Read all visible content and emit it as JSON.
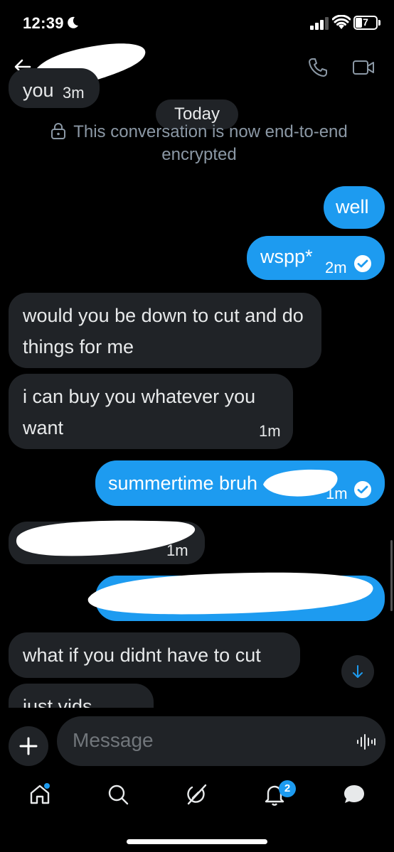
{
  "status_bar": {
    "time": "12:39",
    "battery_level": "7"
  },
  "conversation": {
    "earlier_fragment": {
      "text": "you",
      "time": "3m"
    },
    "date_separator": "Today",
    "encryption_notice": "This conversation is now end-to-end encrypted",
    "messages": [
      {
        "direction": "out",
        "text": "well",
        "time": ""
      },
      {
        "direction": "out",
        "text": "wspp*",
        "time": "2m"
      },
      {
        "direction": "in",
        "text": "would you be down to cut and do things for me",
        "time": ""
      },
      {
        "direction": "in",
        "text": "i can buy you whatever you want",
        "time": "1m"
      },
      {
        "direction": "out",
        "text": "summertime bruh",
        "time": "1m"
      },
      {
        "direction": "in",
        "text": "",
        "time": "1m"
      },
      {
        "direction": "out",
        "text": "",
        "time": ""
      },
      {
        "direction": "in",
        "text": "what if you didnt have to cut",
        "time": ""
      },
      {
        "direction": "in",
        "text": "just vids",
        "time": ""
      }
    ]
  },
  "composer": {
    "placeholder": "Message"
  },
  "tabbar": {
    "items": [
      {
        "icon": "home-icon",
        "badge": ""
      },
      {
        "icon": "search-icon",
        "badge": ""
      },
      {
        "icon": "grok-icon",
        "badge": ""
      },
      {
        "icon": "bell-icon",
        "badge": "2"
      },
      {
        "icon": "messages-icon",
        "badge": ""
      }
    ]
  },
  "colors": {
    "accent": "#1d9bf0",
    "incoming_bubble": "#202327",
    "background": "#000000"
  }
}
